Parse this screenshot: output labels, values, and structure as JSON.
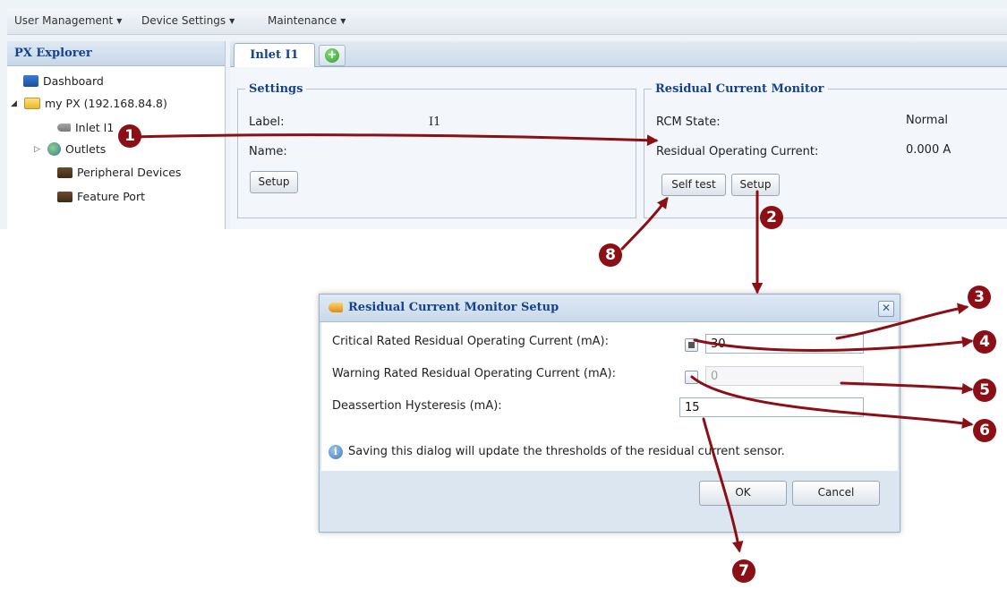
{
  "menubar": {
    "items": [
      {
        "label": "User Management"
      },
      {
        "label": "Device Settings"
      },
      {
        "label": "Maintenance"
      }
    ]
  },
  "explorer": {
    "title": "PX Explorer",
    "items": [
      {
        "label": "Dashboard",
        "icon": "dashboard-icon"
      },
      {
        "label": "my PX (192.168.84.8)",
        "icon": "folder-icon"
      },
      {
        "label": "Inlet I1",
        "icon": "inlet-icon"
      },
      {
        "label": "Outlets",
        "icon": "globe-icon"
      },
      {
        "label": "Peripheral Devices",
        "icon": "device-icon"
      },
      {
        "label": "Feature Port",
        "icon": "device-icon"
      }
    ]
  },
  "tabs": {
    "active_label": "Inlet I1",
    "add_icon": "plus-circle-icon"
  },
  "settings": {
    "legend": "Settings",
    "label_caption": "Label:",
    "label_value": "I1",
    "name_caption": "Name:",
    "setup_button": "Setup"
  },
  "rcm": {
    "legend": "Residual Current Monitor",
    "state_caption": "RCM State:",
    "state_value": "Normal",
    "current_caption": "Residual Operating Current:",
    "current_value": "0.000 A",
    "selftest_button": "Self test",
    "setup_button": "Setup"
  },
  "dialog": {
    "title": "Residual Current Monitor Setup",
    "critical_label": "Critical Rated Residual Operating Current (mA):",
    "critical_checked": true,
    "critical_value": "30",
    "warning_label": "Warning Rated Residual Operating Current (mA):",
    "warning_checked": false,
    "warning_value": "0",
    "hysteresis_label": "Deassertion Hysteresis (mA):",
    "hysteresis_value": "15",
    "info_text": "Saving this dialog will update the thresholds of the residual current sensor.",
    "ok_button": "OK",
    "cancel_button": "Cancel"
  },
  "callouts": [
    "1",
    "2",
    "3",
    "4",
    "5",
    "6",
    "7",
    "8"
  ],
  "colors": {
    "callout": "#8b0f14",
    "header_text": "#15428b"
  }
}
